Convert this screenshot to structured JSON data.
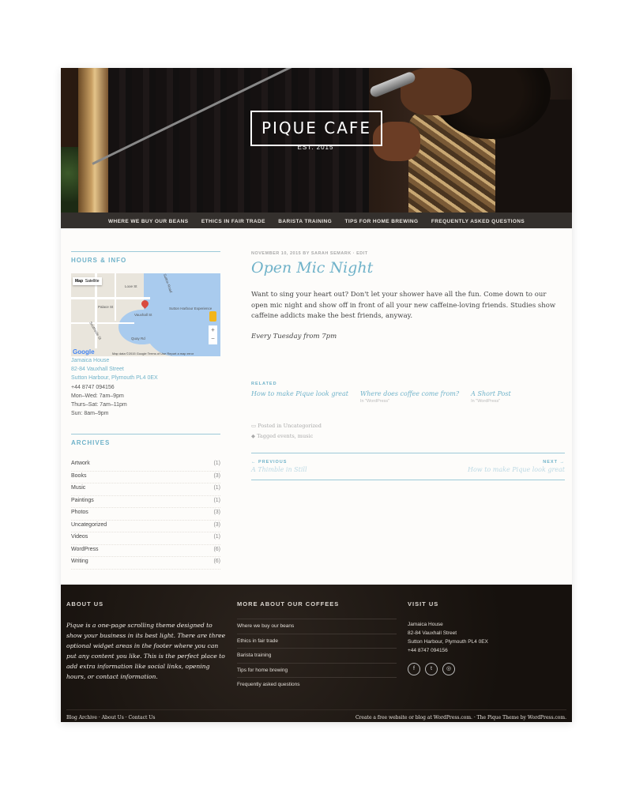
{
  "site": {
    "logo": "PIQUE CAFE",
    "logo_sub": "EST. 2015"
  },
  "nav": {
    "items": [
      "WHERE WE BUY OUR BEANS",
      "ETHICS IN FAIR TRADE",
      "BARISTA TRAINING",
      "TIPS FOR HOME BREWING",
      "FREQUENTLY ASKED QUESTIONS"
    ]
  },
  "sidebar": {
    "hours_title": "HOURS & INFO",
    "map": {
      "type_label": "Map",
      "type_label2": "Satellite",
      "streets": [
        "Palace St",
        "Looe St",
        "Sutton Road",
        "Southside St",
        "Quay Rd",
        "Vauxhall St",
        "Sutton Harbour Experience"
      ],
      "attribution": "Map data ©2015 Google   Terms of Use   Report a map error",
      "google": "Google"
    },
    "address": {
      "line1": "Jamaica House",
      "line2": "82-84 Vauxhall Street",
      "line3": "Sutton Harbour, Plymouth PL4 0EX",
      "phone": "+44 8747 094156",
      "hours1": "Mon–Wed: 7am–9pm",
      "hours2": "Thurs–Sat: 7am–11pm",
      "hours3": "Sun: 8am–9pm"
    },
    "archives_title": "ARCHIVES",
    "archives": [
      {
        "name": "Artwork",
        "count": "(1)"
      },
      {
        "name": "Books",
        "count": "(3)"
      },
      {
        "name": "Music",
        "count": "(1)"
      },
      {
        "name": "Paintings",
        "count": "(1)"
      },
      {
        "name": "Photos",
        "count": "(3)"
      },
      {
        "name": "Uncategorized",
        "count": "(3)"
      },
      {
        "name": "Videos",
        "count": "(1)"
      },
      {
        "name": "WordPress",
        "count": "(6)"
      },
      {
        "name": "Writing",
        "count": "(6)"
      }
    ]
  },
  "post": {
    "meta": "NOVEMBER 10, 2015 BY SARAH SEMARK · EDIT",
    "title": "Open Mic Night",
    "body": "Want to sing your heart out? Don't let your shower have all the fun. Come down to our open mic night and show off in front of all your new caffeine-loving friends. Studies show caffeine addicts make the best friends, anyway.",
    "emphasis": "Every Tuesday from 7pm",
    "related_title": "RELATED",
    "related": [
      {
        "title": "How to make Pique look great",
        "sub": ""
      },
      {
        "title": "Where does coffee come from?",
        "sub": "In \"WordPress\""
      },
      {
        "title": "A Short Post",
        "sub": "In \"WordPress\""
      }
    ],
    "posted_in": "Posted in Uncategorized",
    "tagged": "Tagged events, music",
    "prev_label": "← PREVIOUS",
    "prev_title": "A Thimble in Still",
    "next_label": "NEXT →",
    "next_title": "How to make Pique look great"
  },
  "footer": {
    "about_title": "ABOUT US",
    "about_text": "Pique is a one-page scrolling theme designed to show your business in its best light. There are three optional widget areas in the footer where you can put any content you like. This is the perfect place to add extra information like social links, opening hours, or contact information.",
    "more_title": "MORE ABOUT OUR COFFEES",
    "more_links": [
      "Where we buy our beans",
      "Ethics in fair trade",
      "Barista training",
      "Tips for home brewing",
      "Frequently asked questions"
    ],
    "visit_title": "VISIT US",
    "visit": {
      "line1": "Jamaica House",
      "line2": "82-84 Vauxhall Street",
      "line3": "Sutton Harbour, Plymouth PL4 0EX",
      "phone": "+44 8747 094156"
    },
    "social_icons": [
      "facebook-icon",
      "twitter-icon",
      "instagram-icon"
    ],
    "bottom_left": "Blog Archive · About Us · Contact Us",
    "bottom_right": "Create a free website or blog at WordPress.com. · The Pique Theme by WordPress.com."
  },
  "colors": {
    "accent": "#6fb2c9",
    "nav_bg": "#34302d",
    "footer_bg": "#1c1612"
  }
}
